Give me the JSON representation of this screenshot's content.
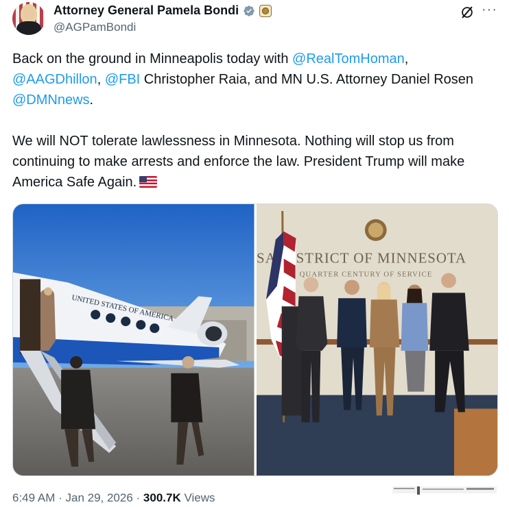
{
  "author": {
    "display_name": "Attorney General Pamela Bondi",
    "handle": "@AGPamBondi",
    "verified_icon": "verified-badge-icon",
    "affiliate_icon": "government-affiliation-icon"
  },
  "actions": {
    "grok_icon": "grok-icon",
    "more_label": "···"
  },
  "tweet": {
    "p1_t1": "Back on the ground in Minneapolis today with ",
    "p1_m1": "@RealTomHoman",
    "p1_t2": ",",
    "p1_m2": "@AAGDhillon",
    "p1_t3": ", ",
    "p1_m3": "@FBI",
    "p1_t4": " Christopher Raia, and MN U.S. Attorney Daniel Rosen ",
    "p1_m4": "@DMNnews",
    "p1_t5": ".",
    "p2": "We will NOT tolerate lawlessness in Minnesota. Nothing will stop us from continuing to make arrests and enforce the law.  President Trump will make America Safe Again.",
    "flag_emoji": "us-flag-emoji"
  },
  "media": {
    "photo_left": {
      "plane_text": "UNITED STATES OF AMERICA"
    },
    "photo_right": {
      "wall_text": "SA DISTRICT OF MINNESOTA",
      "sub_text": "QUARTER CENTURY OF SERVICE"
    }
  },
  "footer": {
    "time": "6:49 AM",
    "sep": " · ",
    "date": "Jan 29, 2026",
    "sep2": " · ",
    "views_count": "300.7K",
    "views_label": " Views"
  },
  "colors": {
    "link": "#1d9bf0",
    "muted": "#536471",
    "text": "#0f1419"
  }
}
